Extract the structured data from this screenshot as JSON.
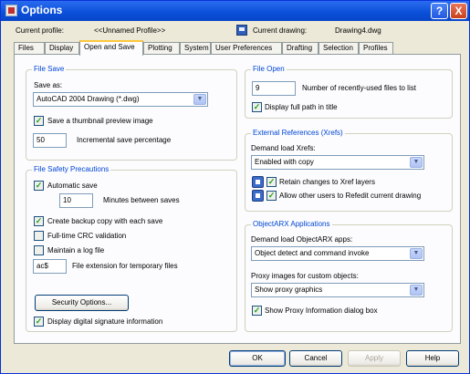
{
  "window": {
    "title": "Options",
    "help_glyph": "?",
    "close_glyph": "X"
  },
  "header": {
    "profile_label": "Current profile:",
    "profile_value": "<<Unnamed Profile>>",
    "drawing_label": "Current drawing:",
    "drawing_value": "Drawing4.dwg"
  },
  "tabs": [
    "Files",
    "Display",
    "Open and Save",
    "Plotting",
    "System",
    "User Preferences",
    "Drafting",
    "Selection",
    "Profiles"
  ],
  "active_tab": "Open and Save",
  "file_save": {
    "title": "File Save",
    "save_as_label": "Save as:",
    "save_as_value": "AutoCAD 2004 Drawing (*.dwg)",
    "thumbnail_label": "Save a thumbnail preview image",
    "thumbnail_checked": true,
    "incremental_value": "50",
    "incremental_label": "Incremental save percentage"
  },
  "file_safety": {
    "title": "File Safety Precautions",
    "autosave_label": "Automatic save",
    "autosave_checked": true,
    "minutes_value": "10",
    "minutes_label": "Minutes between saves",
    "backup_label": "Create backup copy with each save",
    "backup_checked": true,
    "crc_label": "Full-time CRC validation",
    "crc_checked": false,
    "log_label": "Maintain a log file",
    "log_checked": false,
    "ext_value": "ac$",
    "ext_label": "File extension for temporary files",
    "security_button": "Security Options...",
    "signature_label": "Display digital signature information",
    "signature_checked": true
  },
  "file_open": {
    "title": "File Open",
    "recent_value": "9",
    "recent_label": "Number of recently-used files to list",
    "fullpath_label": "Display full path in title",
    "fullpath_checked": true
  },
  "xrefs": {
    "title": "External References (Xrefs)",
    "demand_label": "Demand load Xrefs:",
    "demand_value": "Enabled with copy",
    "retain_label": "Retain changes to Xref layers",
    "retain_checked": true,
    "allow_label": "Allow other users to Refedit current drawing",
    "allow_checked": true
  },
  "objectarx": {
    "title": "ObjectARX Applications",
    "demand_label": "Demand load ObjectARX apps:",
    "demand_value": "Object detect and command invoke",
    "proxy_label": "Proxy images for custom objects:",
    "proxy_value": "Show proxy graphics",
    "show_proxy_label": "Show Proxy Information dialog box",
    "show_proxy_checked": true
  },
  "buttons": {
    "ok": "OK",
    "cancel": "Cancel",
    "apply": "Apply",
    "help": "Help"
  },
  "glyphs": {
    "check": "✓",
    "dropdown": "▼"
  }
}
